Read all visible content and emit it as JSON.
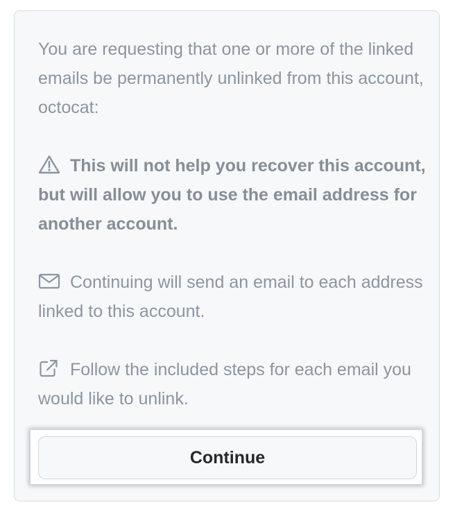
{
  "dialog": {
    "intro_text": "You are requesting that one or more of the linked emails be permanently unlinked from this account, octocat:",
    "warning": {
      "icon": "alert-triangle-icon",
      "text": "This will not help you recover this account, but will allow you to use the email address for another account."
    },
    "email_notice": {
      "icon": "mail-icon",
      "text": "Continuing will send an email to each address linked to this account."
    },
    "steps_notice": {
      "icon": "external-link-icon",
      "text": "Follow the included steps for each email you would like to unlink."
    },
    "continue_label": "Continue"
  },
  "colors": {
    "card_background": "#f6f8fa",
    "muted_text": "#8c959f",
    "button_text": "#24292f",
    "border": "#d0d7de"
  }
}
